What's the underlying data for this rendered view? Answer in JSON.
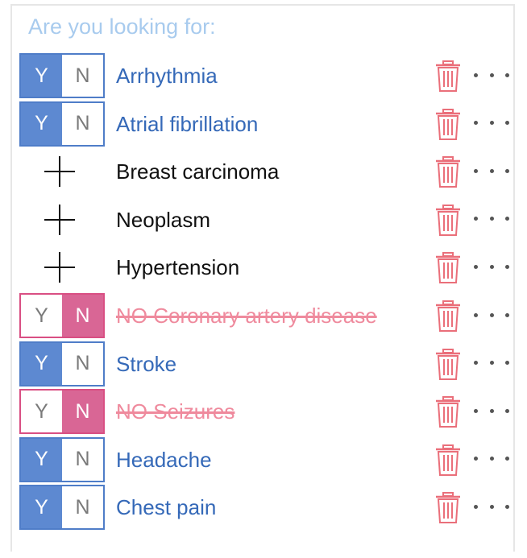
{
  "prompt": "Are you looking for:",
  "toggle": {
    "yes": "Y",
    "no": "N"
  },
  "colors": {
    "accent_blue": "#4f7dc8",
    "negative_pink": "#d96695",
    "trash_red": "#ea6f7a",
    "prompt_blue": "#a8cbee"
  },
  "icons": {
    "delete": "trash-icon",
    "more": "more-options-icon",
    "add": "plus-icon"
  },
  "conditions": [
    {
      "label": "Arrhythmia",
      "state": "yes"
    },
    {
      "label": "Atrial fibrillation",
      "state": "yes"
    },
    {
      "label": "Breast carcinoma",
      "state": "none"
    },
    {
      "label": "Neoplasm",
      "state": "none"
    },
    {
      "label": "Hypertension",
      "state": "none"
    },
    {
      "label": "NO Coronary artery disease",
      "state": "no"
    },
    {
      "label": "Stroke",
      "state": "yes"
    },
    {
      "label": "NO Seizures",
      "state": "no"
    },
    {
      "label": "Headache",
      "state": "yes"
    },
    {
      "label": "Chest pain",
      "state": "yes"
    }
  ]
}
